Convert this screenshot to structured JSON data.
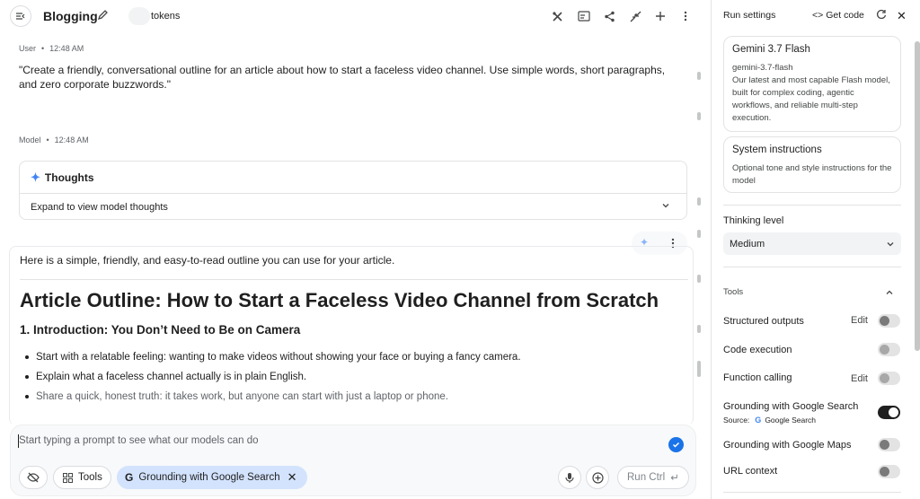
{
  "header": {
    "title": "Blogging",
    "tokens_label": "tokens",
    "icons": [
      "tools-icon",
      "compare-icon",
      "share-icon",
      "collapse-icon",
      "add-icon",
      "more-vert-icon"
    ]
  },
  "chat": {
    "user": {
      "role": "User",
      "time": "12:48 AM",
      "text": "\"Create a friendly, conversational outline for an article about how to start a faceless video channel. Use simple words, short paragraphs, and zero corporate buzzwords.\""
    },
    "model": {
      "role": "Model",
      "time": "12:48 AM",
      "thoughts_title": "Thoughts",
      "thoughts_expand": "Expand to view model thoughts",
      "intro": "Here is a simple, friendly, and easy-to-read outline you can use for your article.",
      "heading": "Article Outline: How to Start a Faceless Video Channel from Scratch",
      "subheading": "1. Introduction: You Don’t Need to Be on Camera",
      "bullets": [
        "Start with a relatable feeling: wanting to make videos without showing your face or buying a fancy camera.",
        "Explain what a faceless channel actually is in plain English.",
        "Share a quick, honest truth: it takes work, but anyone can start with just a laptop or phone."
      ]
    }
  },
  "prompt": {
    "placeholder": "Start typing a prompt to see what our models can do",
    "tools_label": "Tools",
    "grounding_chip": "Grounding with Google Search",
    "run_label": "Run Ctrl"
  },
  "panel": {
    "title": "Run settings",
    "get_code": "Get code",
    "model": {
      "name": "Gemini 3.7 Flash",
      "id": "gemini-3.7-flash",
      "description": "Our latest and most capable Flash model, built for complex coding, agentic workflows, and reliable multi-step execution."
    },
    "system_instructions": {
      "title": "System instructions",
      "description": "Optional tone and style instructions for the model"
    },
    "thinking": {
      "label": "Thinking level",
      "value": "Medium"
    },
    "tools_label": "Tools",
    "edit_label": "Edit",
    "tools": [
      {
        "label": "Structured outputs",
        "edit": true,
        "on": false
      },
      {
        "label": "Code execution",
        "edit": false,
        "on": false
      },
      {
        "label": "Function calling",
        "edit": true,
        "on": false
      },
      {
        "label": "Grounding with Google Search",
        "edit": false,
        "on": true
      },
      {
        "label": "Grounding with Google Maps",
        "edit": false,
        "on": false
      },
      {
        "label": "URL context",
        "edit": false,
        "on": false
      }
    ],
    "source_label": "Source:",
    "source_value": "Google Search"
  },
  "colors": {
    "accent": "#1a73e8",
    "chip_bg": "#d3e3fd",
    "spark": "#4285f4"
  }
}
